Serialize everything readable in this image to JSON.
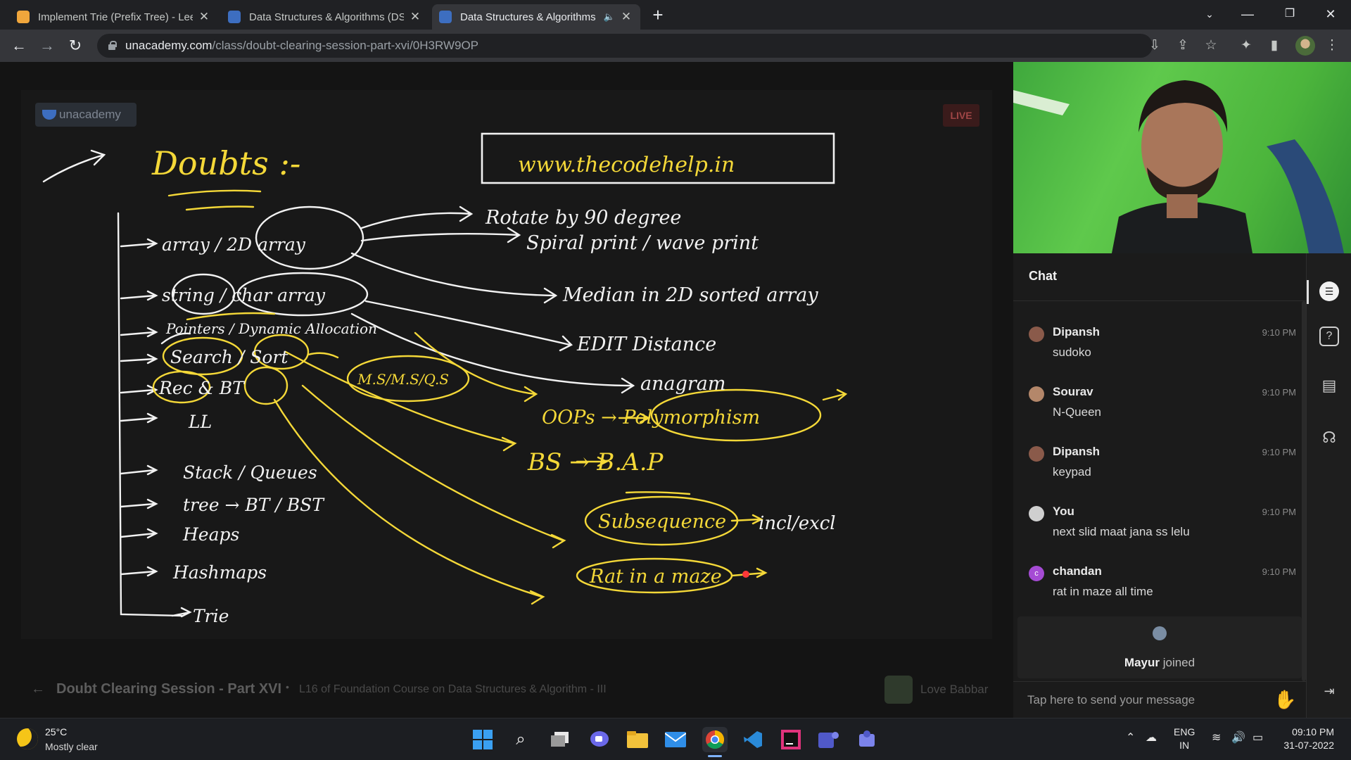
{
  "tabs": [
    {
      "title": "Implement Trie (Prefix Tree) - LeetCode",
      "favicon": "leetcode-icon",
      "color": "#f0a63c"
    },
    {
      "title": "Data Structures & Algorithms (DSA)",
      "favicon": "unacademy-icon",
      "color": "#3d6ec0"
    },
    {
      "title": "Data Structures & Algorithms",
      "favicon": "unacademy-icon",
      "color": "#3d6ec0",
      "active": true
    }
  ],
  "address": {
    "host": "unacademy.com",
    "path": "/class/doubt-clearing-session-part-xvi/0H3RW9OP"
  },
  "page": {
    "brand": "unacademy",
    "live_badge": "LIVE",
    "session_title": "Doubt Clearing Session - Part XVI",
    "session_subtitle": "L16 of Foundation Course on Data Structures & Algorithm - III",
    "educator": "Love Babbar"
  },
  "whiteboard": {
    "heading": "Doubts :-",
    "website": "www.thecodehelp.in",
    "topics": [
      "array / 2D array",
      "string / char array",
      "Pointers / Dynamic Allocation",
      "Search / Sort",
      "Rec & BT",
      "LL",
      "Stack / Queues",
      "tree → BT / BST",
      "Heaps",
      "Hashmaps",
      "Trie"
    ],
    "doubts": [
      "Rotate by 90 degree",
      "Spiral print / wave print",
      "Median in 2D sorted array",
      "EDIT Distance",
      "anagram",
      "OOPs → Polymorphism",
      "BS → B.A.P",
      "Subsequence → incl/excl",
      "Rat in a maze"
    ],
    "sort_note": "M.S/M.S/Q.S"
  },
  "chat": {
    "title": "Chat",
    "messages": [
      {
        "name": "Dipansh",
        "time": "9:10 PM",
        "text": "sudoko",
        "avatar": "#8a5a4a"
      },
      {
        "name": "Sourav",
        "time": "9:10 PM",
        "text": "N-Queen",
        "avatar": "#b4876a"
      },
      {
        "name": "Dipansh",
        "time": "9:10 PM",
        "text": "keypad",
        "avatar": "#8a5a4a"
      },
      {
        "name": "You",
        "time": "9:10 PM",
        "text": "next slid maat jana ss lelu",
        "avatar": "#cfcfcf"
      },
      {
        "name": "chandan",
        "time": "9:10 PM",
        "text": "rat in maze all time",
        "avatar": "#a54bd4",
        "initial": "c"
      }
    ],
    "joined_name": "Mayur",
    "joined_suffix": " joined",
    "input_placeholder": "Tap here to send your message"
  },
  "taskbar": {
    "temp": "25°C",
    "condition": "Mostly clear",
    "lang_line1": "ENG",
    "lang_line2": "IN",
    "time": "09:10 PM",
    "date": "31-07-2022"
  }
}
